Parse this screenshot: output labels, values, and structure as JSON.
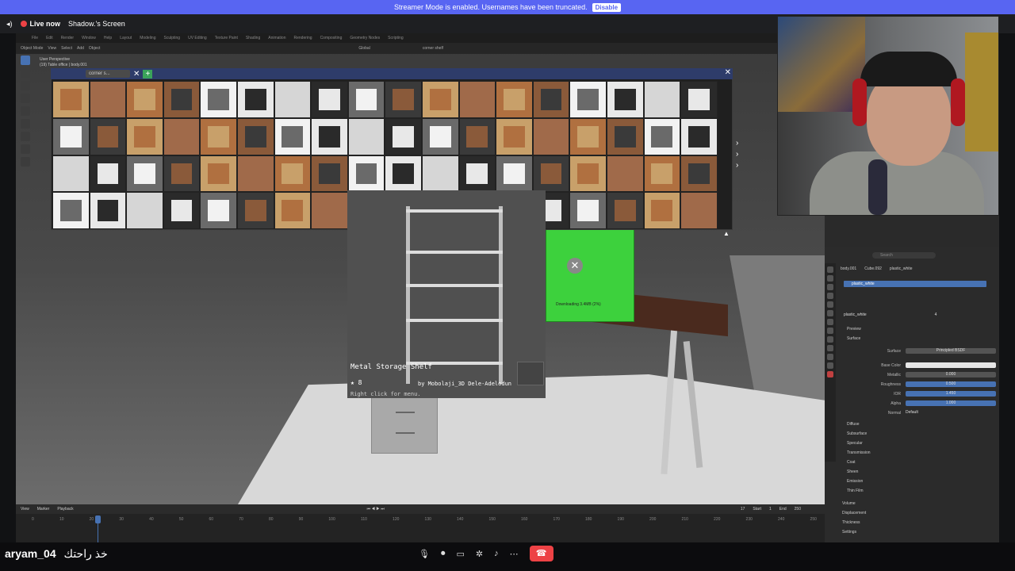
{
  "banner": {
    "text": "Streamer Mode is enabled. Usernames have been truncated.",
    "button": "Disable"
  },
  "stream": {
    "live_label": "Live now",
    "screen_label": "Shadow.'s Screen"
  },
  "blender": {
    "menu": [
      "File",
      "Edit",
      "Render",
      "Window",
      "Help",
      "Layout",
      "Modeling",
      "Sculpting",
      "UV Editing",
      "Texture Paint",
      "Shading",
      "Animation",
      "Rendering",
      "Compositing",
      "Geometry Nodes",
      "Scripting"
    ],
    "mode": "Object Mode",
    "view_menus": [
      "View",
      "Select",
      "Add",
      "Object"
    ],
    "orientation": "Global",
    "viewport_search": "corner shelf",
    "perspective": "User Perspective",
    "collection": "(19) Table office | body.001"
  },
  "asset_browser": {
    "search": "corner s...",
    "tile_count": 72,
    "download_msg": "Downloading 3.4MB (2%)"
  },
  "tooltip": {
    "title": "Metal Storage Shelf",
    "rating": "8",
    "author": "by Mobolaji_3D Dele-Adelodun",
    "hint": "Right click for menu."
  },
  "properties": {
    "search": "Search",
    "breadcrumb": [
      "body.001",
      "Cube.092",
      "plastic_white"
    ],
    "slot": "plastic_white",
    "material": "plastic_white",
    "material_users": "4",
    "sections_top": [
      "Preview",
      "Surface"
    ],
    "surface_label": "Surface",
    "surface_value": "Principled BSDF",
    "rows": [
      {
        "label": "Base Color",
        "value": ""
      },
      {
        "label": "Metallic",
        "value": "0.000"
      },
      {
        "label": "Roughness",
        "value": "0.500"
      },
      {
        "label": "IOR",
        "value": "1.450"
      },
      {
        "label": "Alpha",
        "value": "1.000"
      },
      {
        "label": "Normal",
        "value": "Default"
      }
    ],
    "subsections": [
      "Diffuse",
      "Subsurface",
      "Specular",
      "Transmission",
      "Coat",
      "Sheen",
      "Emission",
      "Thin Film"
    ],
    "bottom_sections": [
      "Volume",
      "Displacement",
      "Thickness",
      "Settings"
    ]
  },
  "timeline": {
    "menus": [
      "View",
      "Marker",
      "Playback"
    ],
    "current_frame": "17",
    "start_label": "Start",
    "start": "1",
    "end_label": "End",
    "end": "250",
    "ticks": [
      "0",
      "10",
      "20",
      "30",
      "40",
      "50",
      "60",
      "70",
      "80",
      "90",
      "100",
      "110",
      "120",
      "130",
      "140",
      "150",
      "160",
      "170",
      "180",
      "190",
      "200",
      "210",
      "220",
      "230",
      "240",
      "250"
    ]
  },
  "user": {
    "name": "aryam_04",
    "arabic": "خذ راحتك"
  },
  "colors": {
    "accent": "#4772b3",
    "discord": "#5865f2",
    "end_call": "#ed4245",
    "green_box": "#3dd13d"
  }
}
